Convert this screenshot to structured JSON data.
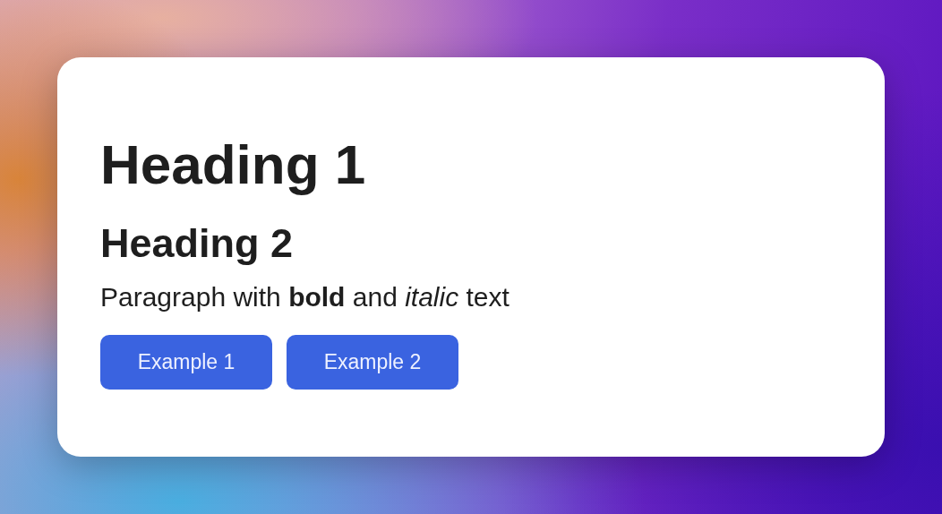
{
  "card": {
    "heading_1": "Heading 1",
    "heading_2": "Heading 2",
    "paragraph": "Paragraph with **bold** and *italic* text",
    "buttons": [
      "Example 1",
      "Example 2"
    ]
  }
}
